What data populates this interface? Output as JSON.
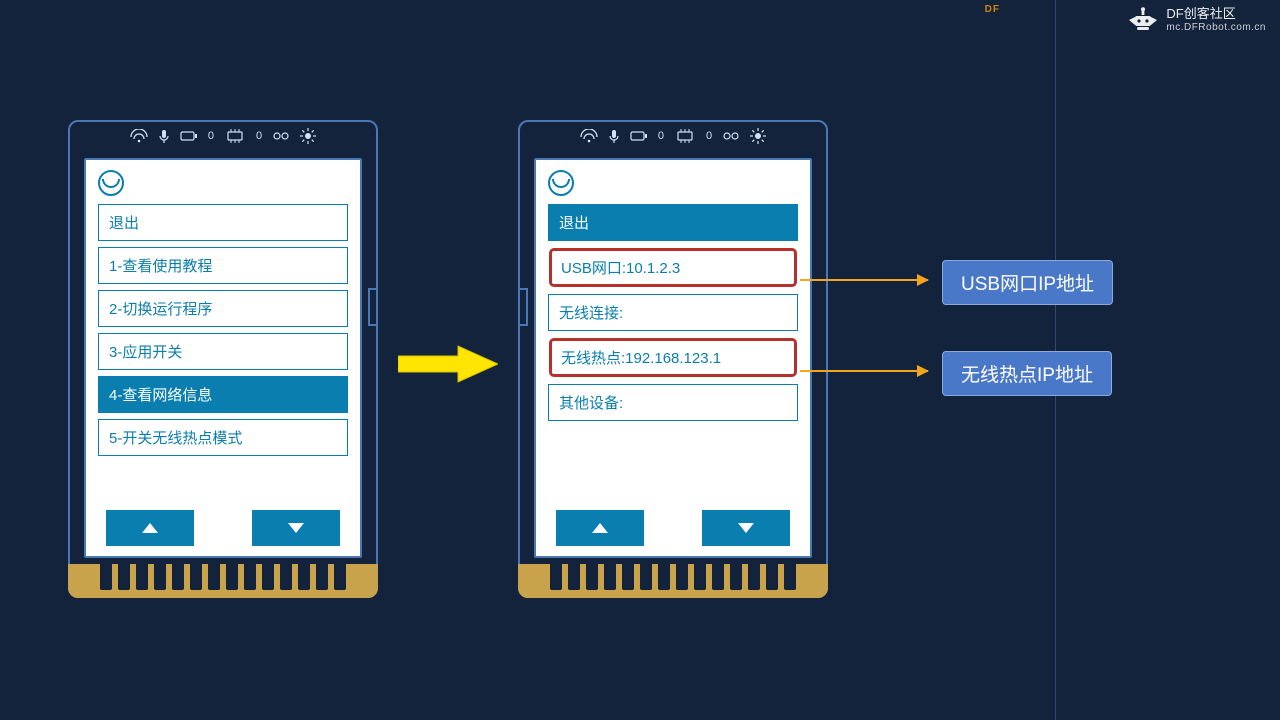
{
  "watermark": {
    "brand": "DF创客社区",
    "url": "mc.DFRobot.com.cn",
    "small_tag": "DF"
  },
  "left_device": {
    "menu": {
      "exit": "退出",
      "items": [
        "1-查看使用教程",
        "2-切换运行程序",
        "3-应用开关",
        "4-查看网络信息",
        "5-开关无线热点模式"
      ],
      "active_index": 3
    }
  },
  "right_device": {
    "menu": {
      "exit": "退出",
      "items": [
        "USB网口:10.1.2.3",
        "无线连接:",
        "无线热点:192.168.123.1",
        "其他设备:"
      ],
      "highlight_indices": [
        0,
        2
      ]
    }
  },
  "callouts": {
    "usb_label": "USB网口IP地址",
    "hotspot_label": "无线热点IP地址"
  }
}
